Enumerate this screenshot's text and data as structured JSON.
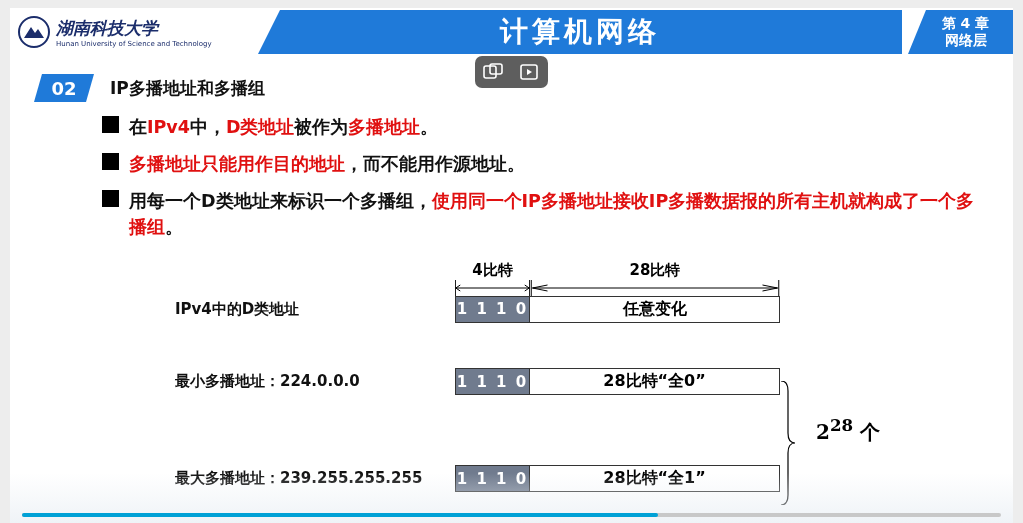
{
  "header": {
    "university": "湖南科技大学",
    "university_en": "Hunan University of Science and Technology",
    "title": "计算机网络",
    "chapter": "第 4 章",
    "chapter_name": "网络层"
  },
  "section": {
    "number": "02",
    "title": "IP多播地址和多播组"
  },
  "bullets": [
    {
      "parts": [
        {
          "text": "在",
          "emphasis": false
        },
        {
          "text": "IPv4",
          "emphasis": true
        },
        {
          "text": "中，",
          "emphasis": false
        },
        {
          "text": "D类地址",
          "emphasis": true
        },
        {
          "text": "被作为",
          "emphasis": false
        },
        {
          "text": "多播地址",
          "emphasis": true
        },
        {
          "text": "。",
          "emphasis": false
        }
      ]
    },
    {
      "parts": [
        {
          "text": "多播地址只能用作目的地址",
          "emphasis": true
        },
        {
          "text": "，而不能用作源地址。",
          "emphasis": false
        }
      ]
    },
    {
      "parts": [
        {
          "text": "用每一个D类地址来标识一个多播组，",
          "emphasis": false
        },
        {
          "text": "使用同一个IP多播地址接收IP多播数据报的所有主机就构成了一个多播组",
          "emphasis": true
        },
        {
          "text": "。",
          "emphasis": false
        }
      ]
    }
  ],
  "diagram": {
    "widths": [
      "4比特",
      "28比特"
    ],
    "rows": [
      {
        "label": "IPv4中的D类地址",
        "prefix": "1 1 1 0",
        "field": "任意变化"
      },
      {
        "label": "最小多播地址：224.0.0.0",
        "prefix": "1 1 1 0",
        "field": "28比特“全0”"
      },
      {
        "label": "最大多播地址：239.255.255.255",
        "prefix": "1 1 1 0",
        "field": "28比特“全1”"
      }
    ],
    "count": "2$^{28}$ 个"
  },
  "player": {
    "level": 0.65
  }
}
